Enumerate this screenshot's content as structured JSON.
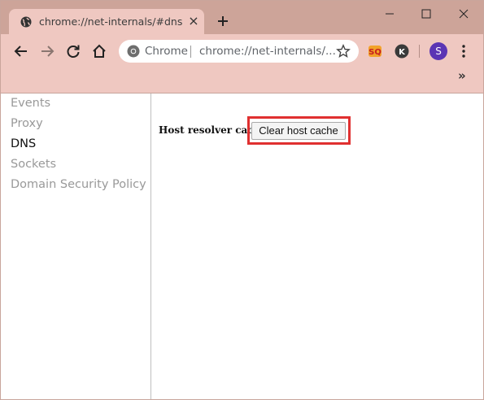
{
  "tab": {
    "title": "chrome://net-internals/#dns",
    "favicon": "globe-icon",
    "close_icon": "close-icon"
  },
  "window_controls": [
    "minimize-icon",
    "maximize-icon",
    "close-icon"
  ],
  "toolbar": {
    "icons": [
      "back-arrow-icon",
      "forward-arrow-icon",
      "reload-icon",
      "home-icon"
    ],
    "omnibox": {
      "site_label": "Chrome",
      "url": "chrome://net-internals/..."
    },
    "extensions": [
      "so-extension-icon",
      "k-extension-icon"
    ],
    "avatar_letter": "S",
    "overflow": "»"
  },
  "sidebar": {
    "items": [
      {
        "label": "Events",
        "active": false
      },
      {
        "label": "Proxy",
        "active": false
      },
      {
        "label": "DNS",
        "active": true
      },
      {
        "label": "Sockets",
        "active": false
      },
      {
        "label": "Domain Security Policy",
        "active": false
      }
    ]
  },
  "main": {
    "resolver_label": "Host resolver cache",
    "clear_button": "Clear host cache"
  },
  "colors": {
    "titlebar": "#cda499",
    "toolbar": "#efc8c1",
    "avatar": "#5b35b4",
    "highlight": "#e03030"
  }
}
